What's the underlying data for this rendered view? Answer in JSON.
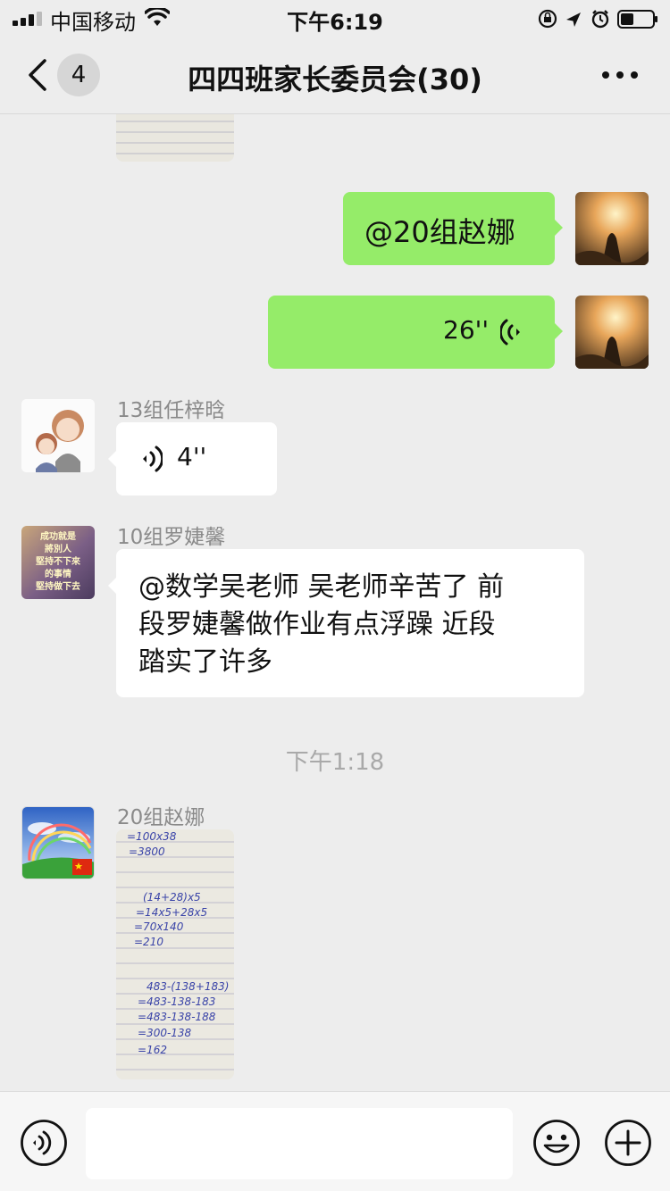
{
  "status_bar": {
    "carrier": "中国移动",
    "time": "下午6:19",
    "icons": [
      "signal-icon",
      "wifi-icon",
      "rotation-lock-icon",
      "location-icon",
      "alarm-icon",
      "battery-icon"
    ]
  },
  "nav": {
    "back_icon": "chevron-left-icon",
    "unread_count": "4",
    "title": "四四班家长委员会(30)",
    "more_icon": "more-icon"
  },
  "messages": {
    "m1": {
      "text": "@20组赵娜"
    },
    "m2": {
      "duration": "26''"
    },
    "m3": {
      "sender": "13组任梓晗",
      "duration": "4''"
    },
    "m4": {
      "sender": "10组罗婕馨",
      "lines": [
        "@数学吴老师 吴老师辛苦了  前",
        "段罗婕馨做作业有点浮躁  近段",
        "踏实了许多"
      ],
      "avatar_text": [
        "成功就是",
        "將別人",
        "堅持不下來",
        "的事情",
        "堅持做下去"
      ]
    },
    "timestamp": "下午1:18",
    "m5": {
      "sender": "20组赵娜",
      "photo_lines": [
        "=100x38",
        "=3800",
        "(14+28)x5",
        "=14x5+28x5",
        "=70x140",
        "=210",
        "483-(138+183)",
        "=483-138-183",
        "=483-138-188",
        "=300-138",
        "=162"
      ]
    }
  },
  "bottom_bar": {
    "voice_icon": "voice-icon",
    "input_value": "",
    "emoji_icon": "emoji-icon",
    "plus_icon": "plus-icon"
  },
  "colors": {
    "background": "#ededed",
    "outgoing_bubble": "#95ec69",
    "incoming_bubble": "#ffffff",
    "name_text": "#8a8a8a"
  }
}
